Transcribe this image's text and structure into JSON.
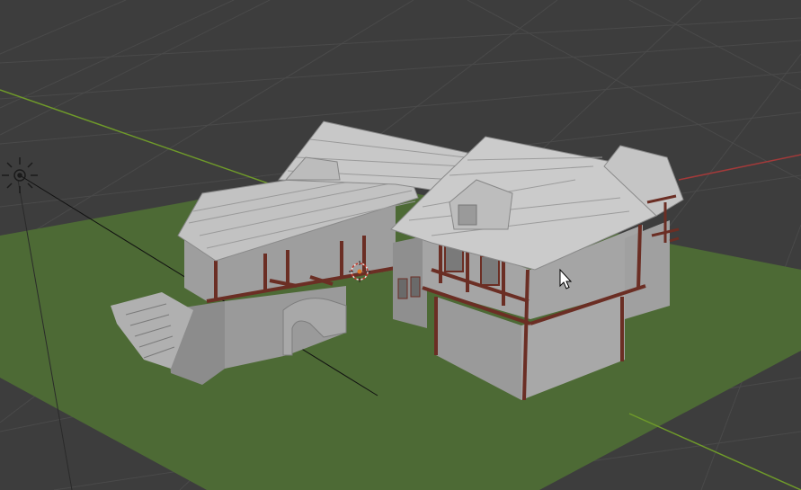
{
  "app": "3D viewport",
  "viewport": {
    "background_color": "#3d3d3d",
    "grid_color": "#4a4a4a",
    "x_axis_color": "#a33a3a",
    "y_axis_color": "#6f9a2a",
    "ground_color": "#4d6a35",
    "wall_color": "#9a9a9a",
    "roof_color": "#c2c2c2",
    "timber_color": "#6b2e24",
    "origin_marker_color": "#e07a2a"
  },
  "scene_objects": [
    {
      "name": "ground-plane",
      "kind": "plane"
    },
    {
      "name": "timber-frame-house",
      "kind": "mesh"
    },
    {
      "name": "stone-staircase",
      "kind": "mesh"
    },
    {
      "name": "arched-gateway",
      "kind": "mesh"
    }
  ],
  "overlays": {
    "light_icon": "sun-light-icon",
    "origin_icon": "3d-cursor-icon",
    "mouse_pointer": "arrow-pointer-icon"
  }
}
